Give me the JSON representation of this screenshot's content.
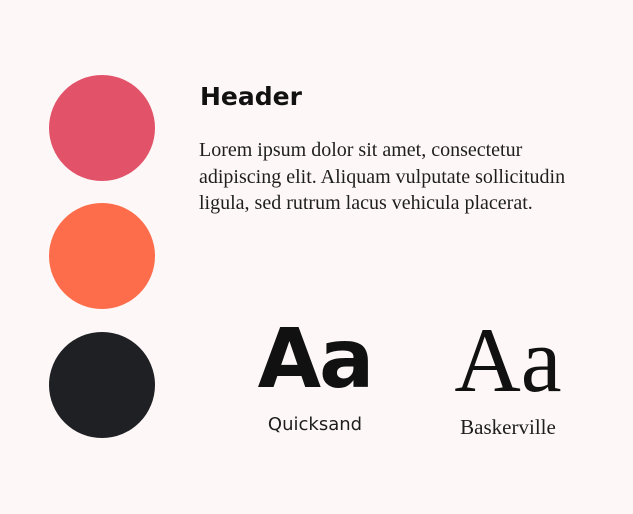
{
  "palette": {
    "colors": [
      "#e2536a",
      "#fd6d4b",
      "#1f2024"
    ]
  },
  "content": {
    "header": "Header",
    "body": "Lorem ipsum dolor sit amet, consectetur adipiscing elit. Aliquam vulputate sollicitudin ligula, sed rutrum lacus vehicula placerat."
  },
  "typography": {
    "primary": {
      "sample": "Aa",
      "name": "Quicksand"
    },
    "secondary": {
      "sample": "Aa",
      "name": "Baskerville"
    }
  }
}
